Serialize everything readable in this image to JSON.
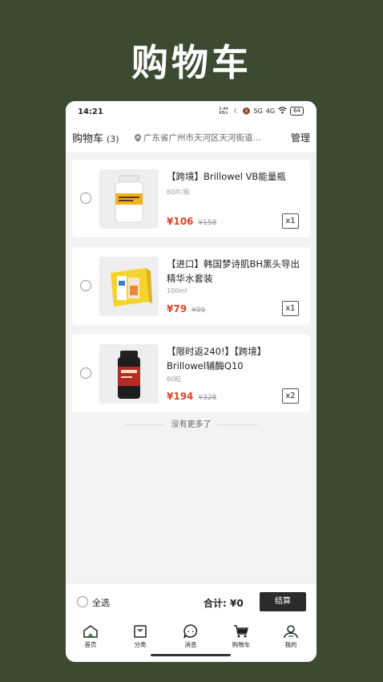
{
  "banner": {
    "title": "购物车"
  },
  "status": {
    "time": "14:21",
    "speed": "2.44 KB/s",
    "signal1": "5G",
    "signal2": "4G",
    "battery": "64"
  },
  "header": {
    "title": "购物车",
    "count": "(3)",
    "location": "广东省广州市天河区天河街道…",
    "manage": "管理"
  },
  "items": [
    {
      "name": "【跨境】Brillowel VB能量瓶",
      "spec": "60片/瓶",
      "price": "¥106",
      "original_price": "¥158",
      "qty": "x1"
    },
    {
      "name": "【进口】韩国梦诗肌BH黑头导出精华水套装",
      "spec": "100ml",
      "price": "¥79",
      "original_price": "¥99",
      "qty": "x1"
    },
    {
      "name": "【限时返240!】【跨境】Brillowel辅酶Q10",
      "spec": "60粒",
      "price": "¥194",
      "original_price": "¥328",
      "qty": "x2"
    }
  ],
  "list_end": "没有更多了",
  "checkout": {
    "select_all": "全选",
    "total_label": "合计:",
    "total_value": "¥0",
    "submit": "结算"
  },
  "tabs": [
    {
      "label": "首页",
      "icon": "home-icon"
    },
    {
      "label": "分类",
      "icon": "category-icon"
    },
    {
      "label": "消息",
      "icon": "message-icon"
    },
    {
      "label": "购物车",
      "icon": "cart-icon"
    },
    {
      "label": "我的",
      "icon": "profile-icon"
    }
  ],
  "colors": {
    "background": "#3c4a32",
    "price": "#d9442b",
    "button": "#2b2b2b"
  }
}
